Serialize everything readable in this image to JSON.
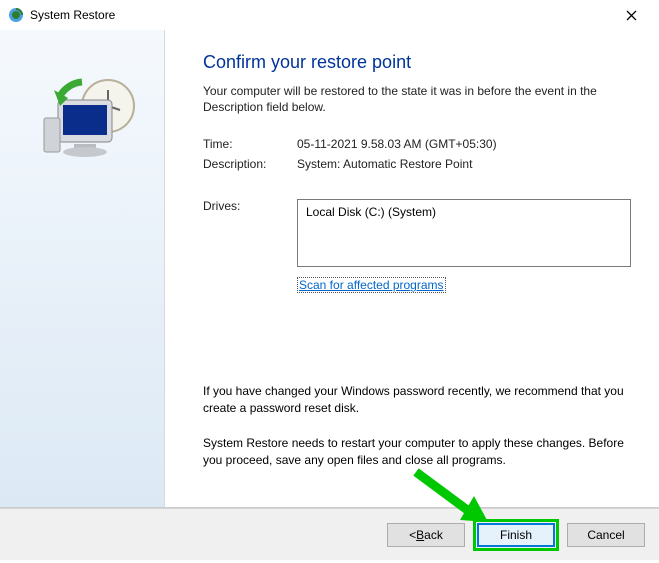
{
  "titlebar": {
    "title": "System Restore"
  },
  "main": {
    "heading": "Confirm your restore point",
    "subtext": "Your computer will be restored to the state it was in before the event in the Description field below.",
    "time_label": "Time:",
    "time_value": "05-11-2021 9.58.03 AM (GMT+05:30)",
    "desc_label": "Description:",
    "desc_value": "System: Automatic Restore Point",
    "drives_label": "Drives:",
    "drives_value": "Local Disk (C:) (System)",
    "scan_link": "Scan for affected programs",
    "warn1": "If you have changed your Windows password recently, we recommend that you create a password reset disk.",
    "warn2": "System Restore needs to restart your computer to apply these changes. Before you proceed, save any open files and close all programs."
  },
  "footer": {
    "back_prefix": "< ",
    "back_u": "B",
    "back_rest": "ack",
    "finish": "Finish",
    "cancel": "Cancel"
  }
}
